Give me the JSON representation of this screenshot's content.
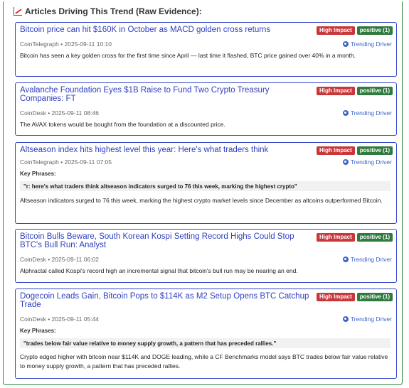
{
  "section": {
    "title": "Articles Driving This Trend (Raw Evidence):",
    "icon": "chart-increasing-icon"
  },
  "colors": {
    "impact": "#c8373a",
    "positive": "#2f7a3e",
    "link": "#3040c0",
    "border": "#3346c9"
  },
  "articles": [
    {
      "title": "Bitcoin price can hit $160K in October as MACD golden cross returns",
      "impact": "High Impact",
      "sentiment": "positive (1)",
      "meta": "CoinTelegraph • 2025-09-11 10:10",
      "driver": "Trending Driver",
      "summary": "Bitcoin has seen a key golden cross for the first time since April — last time it flashed, BTC price gained over 40% in a month."
    },
    {
      "title": "Avalanche Foundation Eyes $1B Raise to Fund Two Crypto Treasury Companies: FT",
      "impact": "High Impact",
      "sentiment": "positive (1)",
      "meta": "CoinDesk • 2025-09-11 08:46",
      "driver": "Trending Driver",
      "summary": "The AVAX tokens would be bought from the foundation at a discounted price."
    },
    {
      "title": "Altseason index hits highest level this year: Here's what traders think",
      "impact": "High Impact",
      "sentiment": "positive (1)",
      "meta": "CoinTelegraph • 2025-09-11 07:05",
      "driver": "Trending Driver",
      "key_phrases_label": "Key Phrases:",
      "key_phrase": "\"r: here's what traders think altseason indicators surged to 76 this week, marking the highest crypto\"",
      "summary": "Altseason indicators surged to 76 this week, marking the highest crypto market levels since December as altcoins outperformed Bitcoin."
    },
    {
      "title": "Bitcoin Bulls Beware, South Korean Kospi Setting Record Highs Could Stop BTC's Bull Run: Analyst",
      "impact": "High Impact",
      "sentiment": "positive (1)",
      "meta": "CoinDesk • 2025-09-11 06:02",
      "driver": "Trending Driver",
      "summary": "Alphractal called Kospi's record high an incremental signal that bitcoin's bull run may be nearing an end."
    },
    {
      "title": "Dogecoin Leads Gain, Bitcoin Pops to $114K as M2 Setup Opens BTC Catchup Trade",
      "impact": "High Impact",
      "sentiment": "positive (1)",
      "meta": "CoinDesk • 2025-09-11 05:44",
      "driver": "Trending Driver",
      "key_phrases_label": "Key Phrases:",
      "key_phrase": "\"trades below fair value relative to money supply growth, a pattern that has preceded rallies.\"",
      "summary": "Crypto edged higher with bitcoin near $114K and DOGE leading, while a CF Benchmarks model says BTC trades below fair value relative to money supply growth, a pattern that has preceded rallies."
    }
  ]
}
